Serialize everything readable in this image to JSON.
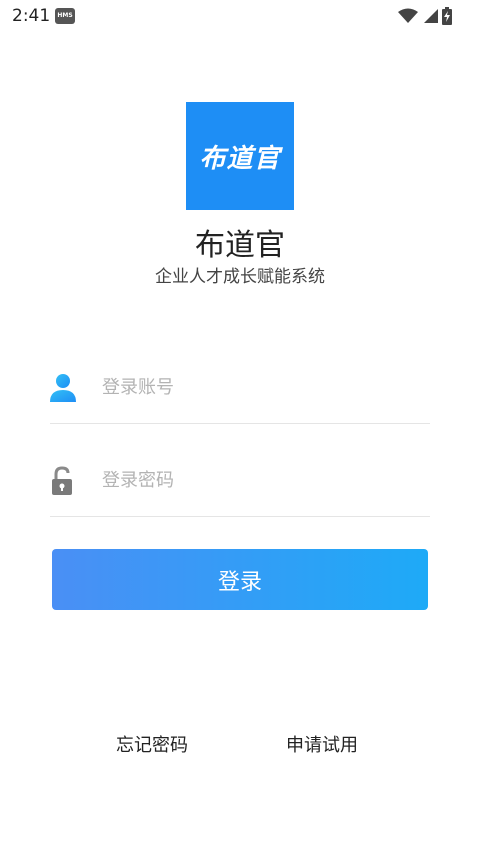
{
  "status_bar": {
    "time": "2:41",
    "badge": "HMS"
  },
  "logo": {
    "text": "布道官",
    "color": "#1e8ef5"
  },
  "app": {
    "name": "布道官",
    "subtitle": "企业人才成长赋能系统"
  },
  "form": {
    "account": {
      "value": "",
      "placeholder": "登录账号",
      "icon": "user-icon"
    },
    "password": {
      "value": "",
      "placeholder": "登录密码",
      "icon": "lock-icon"
    },
    "login_label": "登录",
    "button_gradient": [
      "#4a8ff5",
      "#1eaaf7"
    ]
  },
  "links": {
    "forgot_password": "忘记密码",
    "apply_trial": "申请试用"
  }
}
